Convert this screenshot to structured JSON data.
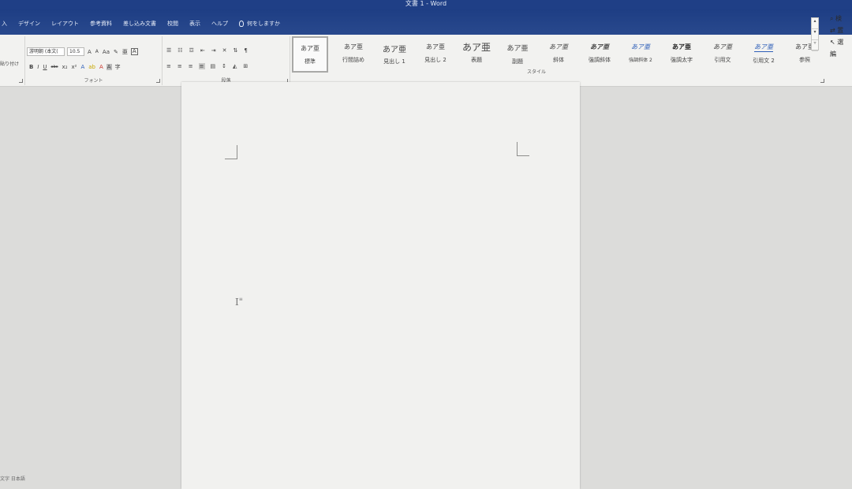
{
  "window": {
    "title": "文書 1 - Word"
  },
  "tabs": [
    "入",
    "デザイン",
    "レイアウト",
    "参考資料",
    "差し込み文書",
    "校閲",
    "表示",
    "ヘルプ"
  ],
  "tell_me": {
    "label": "何をしますか"
  },
  "clipboard": {
    "paste_label": "貼り付け"
  },
  "font_group": {
    "label": "フォント",
    "font_name": "游明朝 (本文(",
    "font_size": "10.5",
    "grow_label": "A",
    "shrink_label": "A",
    "case_label": "Aa",
    "char_border_label": "A",
    "bold": "B",
    "italic": "I",
    "underline": "U",
    "strike": "abc",
    "subscript": "x₂",
    "superscript": "x²",
    "effects": "A",
    "highlight": "ab",
    "font_color": "A",
    "char_shade": "A",
    "enclosed": "字"
  },
  "paragraph_group": {
    "label": "段落"
  },
  "styles_group": {
    "label": "スタイル",
    "items": [
      {
        "sample": "あア亜",
        "name": "標準"
      },
      {
        "sample": "あア亜",
        "name": "行間詰め"
      },
      {
        "sample": "あア亜",
        "name": "見出し 1"
      },
      {
        "sample": "あア亜",
        "name": "見出し 2"
      },
      {
        "sample": "あア亜",
        "name": "表題"
      },
      {
        "sample": "あア亜",
        "name": "副題"
      },
      {
        "sample": "あア亜",
        "name": "斜体"
      },
      {
        "sample": "あア亜",
        "name": "強調斜体"
      },
      {
        "sample": "あア亜",
        "name": "強調斜体 2"
      },
      {
        "sample": "あア亜",
        "name": "強調太字"
      },
      {
        "sample": "あア亜",
        "name": "引用文"
      },
      {
        "sample": "あア亜",
        "name": "引用文 2"
      },
      {
        "sample": "あア亜",
        "name": "参照"
      }
    ]
  },
  "editing": {
    "find": "検",
    "replace": "置",
    "select": "選",
    "label": "編"
  },
  "status": {
    "text": "文字 日本語"
  },
  "colors": {
    "title_bar": "#1f3f86",
    "ribbon": "#f2f2f0",
    "page": "#f1f1ef",
    "workspace": "#dcdcda"
  }
}
